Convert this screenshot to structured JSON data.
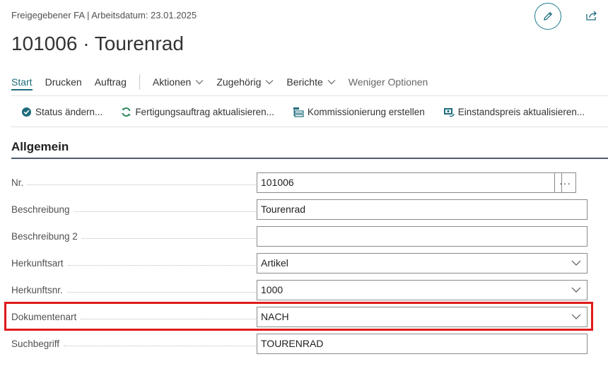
{
  "header": {
    "subtitle": "Freigegebener FA | Arbeitsdatum: 23.01.2025",
    "title": "101006 · Tourenrad"
  },
  "actionbar": {
    "tabs": [
      {
        "label": "Start",
        "active": true
      },
      {
        "label": "Drucken"
      },
      {
        "label": "Auftrag"
      }
    ],
    "menus": [
      {
        "label": "Aktionen"
      },
      {
        "label": "Zugehörig"
      },
      {
        "label": "Berichte"
      }
    ],
    "less_options": "Weniger Optionen"
  },
  "commands": [
    {
      "label": "Status ändern...",
      "icon": "status-change-icon"
    },
    {
      "label": "Fertigungsauftrag aktualisieren...",
      "icon": "refresh-icon"
    },
    {
      "label": "Kommissionierung erstellen",
      "icon": "pick-list-icon"
    },
    {
      "label": "Einstandspreis aktualisieren...",
      "icon": "cost-update-icon"
    }
  ],
  "section": {
    "title": "Allgemein"
  },
  "fields": {
    "nr": {
      "label": "Nr.",
      "value": "101006"
    },
    "beschreibung": {
      "label": "Beschreibung",
      "value": "Tourenrad"
    },
    "beschreibung2": {
      "label": "Beschreibung 2",
      "value": ""
    },
    "herkunftsart": {
      "label": "Herkunftsart",
      "value": "Artikel"
    },
    "herkunftsnr": {
      "label": "Herkunftsnr.",
      "value": "1000"
    },
    "dokumentenart": {
      "label": "Dokumentenart",
      "value": "NACH"
    },
    "suchbegriff": {
      "label": "Suchbegriff",
      "value": "TOURENRAD"
    }
  },
  "lookup_label": "···",
  "colors": {
    "accent": "#1f6c7c",
    "highlight": "#e01b1b"
  }
}
